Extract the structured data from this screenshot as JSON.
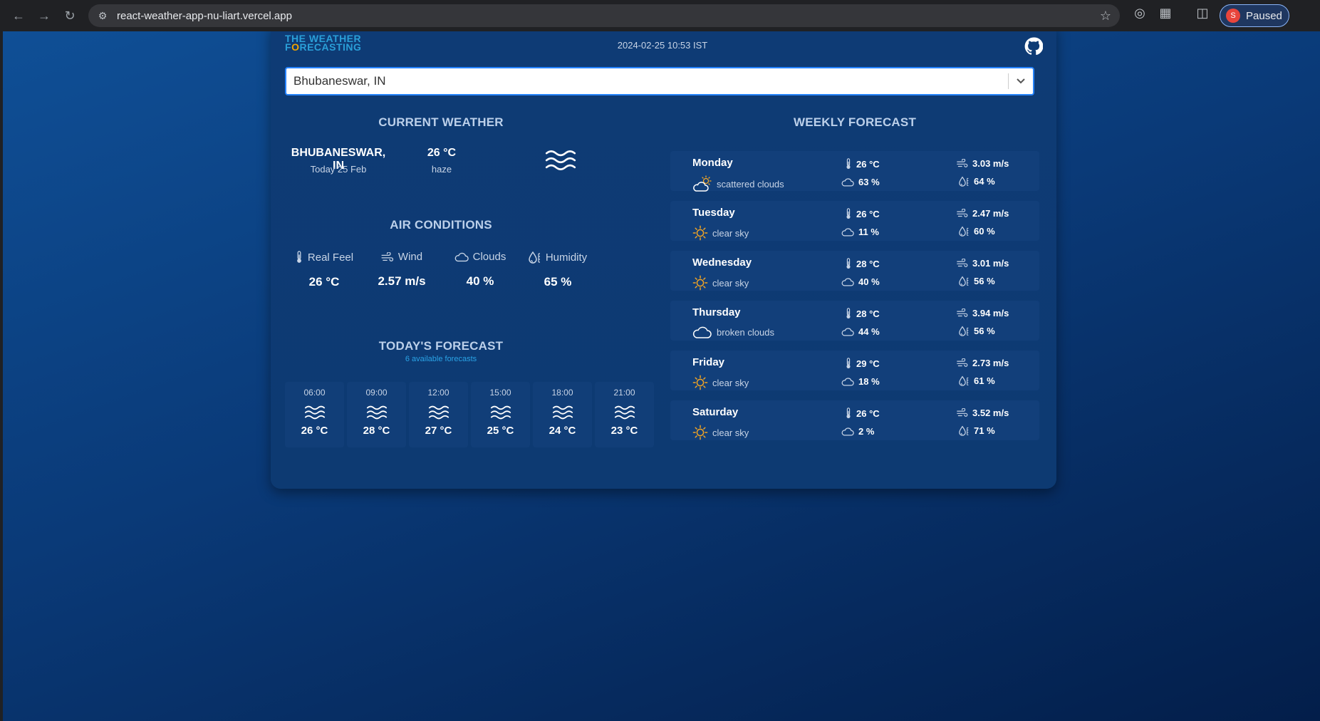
{
  "browser": {
    "url": "react-weather-app-nu-liart.vercel.app",
    "profile_initial": "S",
    "profile_status": "Paused"
  },
  "header": {
    "logo_line1": "The Weather",
    "logo_line2_pre": "F",
    "logo_line2_o": "o",
    "logo_line2_post": "recasting",
    "datetime": "2024-02-25 10:53 IST"
  },
  "search": {
    "value": "Bhubaneswar, IN"
  },
  "current_weather": {
    "title": "CURRENT WEATHER",
    "city": "BHUBANESWAR, IN",
    "date": "Today 25 Feb",
    "temp": "26 °C",
    "description": "haze",
    "icon": "haze-icon"
  },
  "air_conditions": {
    "title": "AIR CONDITIONS",
    "items": [
      {
        "label": "Real Feel",
        "value": "26 °C",
        "icon": "thermometer-icon"
      },
      {
        "label": "Wind",
        "value": "2.57 m/s",
        "icon": "wind-icon"
      },
      {
        "label": "Clouds",
        "value": "40 %",
        "icon": "cloud-icon"
      },
      {
        "label": "Humidity",
        "value": "65 %",
        "icon": "humidity-icon"
      }
    ]
  },
  "todays_forecast": {
    "title": "TODAY'S FORECAST",
    "subtitle": "6 available forecasts",
    "items": [
      {
        "time": "06:00",
        "temp": "26 °C"
      },
      {
        "time": "09:00",
        "temp": "28 °C"
      },
      {
        "time": "12:00",
        "temp": "27 °C"
      },
      {
        "time": "15:00",
        "temp": "25 °C"
      },
      {
        "time": "18:00",
        "temp": "24 °C"
      },
      {
        "time": "21:00",
        "temp": "23 °C"
      }
    ]
  },
  "weekly_forecast": {
    "title": "WEEKLY FORECAST",
    "days": [
      {
        "day": "Monday",
        "desc": "scattered clouds",
        "icon": "scattered-clouds-icon",
        "temp": "26 °C",
        "wind": "3.03 m/s",
        "clouds": "63 %",
        "humidity": "64 %"
      },
      {
        "day": "Tuesday",
        "desc": "clear sky",
        "icon": "sun-icon",
        "temp": "26 °C",
        "wind": "2.47 m/s",
        "clouds": "11 %",
        "humidity": "60 %"
      },
      {
        "day": "Wednesday",
        "desc": "clear sky",
        "icon": "sun-icon",
        "temp": "28 °C",
        "wind": "3.01 m/s",
        "clouds": "40 %",
        "humidity": "56 %"
      },
      {
        "day": "Thursday",
        "desc": "broken clouds",
        "icon": "broken-clouds-icon",
        "temp": "28 °C",
        "wind": "3.94 m/s",
        "clouds": "44 %",
        "humidity": "56 %"
      },
      {
        "day": "Friday",
        "desc": "clear sky",
        "icon": "sun-icon",
        "temp": "29 °C",
        "wind": "2.73 m/s",
        "clouds": "18 %",
        "humidity": "61 %"
      },
      {
        "day": "Saturday",
        "desc": "clear sky",
        "icon": "sun-icon",
        "temp": "26 °C",
        "wind": "3.52 m/s",
        "clouds": "2 %",
        "humidity": "71 %"
      }
    ]
  },
  "colors": {
    "accent_blue": "#2a9fd8",
    "logo_orange": "#f0a500",
    "subtitle_blue": "#2aa3e6",
    "sun_orange": "#f5a623"
  }
}
